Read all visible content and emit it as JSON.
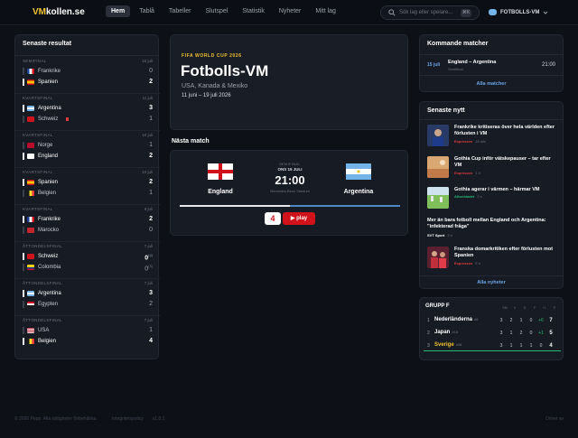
{
  "header": {
    "logo_highlight": "VM",
    "logo_rest": "kollen.se",
    "nav": [
      "Hem",
      "Tablå",
      "Tabeller",
      "Slutspel",
      "Statistik",
      "Nyheter",
      "Mitt lag"
    ],
    "search_placeholder": "Sök lag eller spelare...",
    "search_shortcut": "⌘K",
    "team_selector": "FOTBOLLS-VM"
  },
  "results": {
    "title": "Senaste resultat",
    "matches": [
      {
        "stage": "SEMIFINAL",
        "date": "15 juli",
        "home": {
          "name": "Frankrike",
          "score": "0",
          "win": false
        },
        "away": {
          "name": "Spanien",
          "score": "2",
          "win": true
        }
      },
      {
        "stage": "KVARTSFINAL",
        "date": "11 juli",
        "home": {
          "name": "Argentina",
          "score": "3",
          "win": true
        },
        "away": {
          "name": "Schweiz",
          "score": "1",
          "win": false
        }
      },
      {
        "stage": "KVARTSFINAL",
        "date": "10 juli",
        "home": {
          "name": "Norge",
          "score": "1",
          "win": false
        },
        "away": {
          "name": "England",
          "score": "2",
          "win": true
        }
      },
      {
        "stage": "KVARTSFINAL",
        "date": "10 juli",
        "home": {
          "name": "Spanien",
          "score": "2",
          "win": true
        },
        "away": {
          "name": "Belgien",
          "score": "1",
          "win": false
        }
      },
      {
        "stage": "KVARTSFINAL",
        "date": "9 juli",
        "home": {
          "name": "Frankrike",
          "score": "2",
          "win": true
        },
        "away": {
          "name": "Marocko",
          "score": "0",
          "win": false
        }
      },
      {
        "stage": "ÅTTONDELSFINAL",
        "date": "7 juli",
        "home": {
          "name": "Schweiz",
          "score": "0",
          "pen": "(4)",
          "win": true
        },
        "away": {
          "name": "Colombia",
          "score": "0",
          "pen": "(3)",
          "win": false
        }
      },
      {
        "stage": "ÅTTONDELSFINAL",
        "date": "7 juli",
        "home": {
          "name": "Argentina",
          "score": "3",
          "win": true
        },
        "away": {
          "name": "Egypten",
          "score": "2",
          "win": false
        }
      },
      {
        "stage": "ÅTTONDELSFINAL",
        "date": "7 juli",
        "home": {
          "name": "USA",
          "score": "1",
          "win": false
        },
        "away": {
          "name": "Belgien",
          "score": "4",
          "win": true
        }
      }
    ]
  },
  "hero": {
    "tag": "FIFA WORLD CUP 2026",
    "title": "Fotbolls-VM",
    "subtitle": "USA, Kanada & Mexiko",
    "dates": "11 juni – 19 juli 2026"
  },
  "next_match": {
    "label": "Nästa match",
    "home": "England",
    "away": "Argentina",
    "stage": "SEMIFINAL",
    "date": "ONS 15 JULI",
    "time": "21:00",
    "venue": "Mercedes-Benz Stadium",
    "tv_channel": "4",
    "tv_play": "▶ play"
  },
  "upcoming": {
    "title": "Kommande matcher",
    "date": "15 juli",
    "teams": "England – Argentina",
    "stage": "Semifinal",
    "time": "21:00",
    "link": "Alla matcher"
  },
  "news": {
    "title": "Senaste nytt",
    "items": [
      {
        "title": "Frankrike kritiseras över hela världen efter förlusten i VM",
        "source": "Expressen",
        "ago": "16 min"
      },
      {
        "title": "Gothia Cup inför vätskepauser – tar efter VM",
        "source": "Expressen",
        "ago": "1 h"
      },
      {
        "title": "Gothia agerar i värmen – härmar VM",
        "source": "Aftonbladet",
        "ago": "2 h"
      },
      {
        "title": "Mer än bara fotboll mellan England och Argentina: \"infekterad fråga\"",
        "source": "SVT Sport",
        "ago": "3 h"
      },
      {
        "title": "Franska domarkritiken efter förlusten mot Spanien",
        "source": "Expressen",
        "ago": "5 h"
      }
    ],
    "link": "Alla nyheter"
  },
  "group": {
    "title": "GRUPP F",
    "columns": [
      "SM",
      "V",
      "O",
      "F",
      "+/-",
      "P"
    ],
    "rows": [
      {
        "pos": "1",
        "team": "Nederländerna",
        "rank": "#6",
        "sm": "3",
        "v": "2",
        "o": "1",
        "f": "0",
        "diff": "+6",
        "p": "7"
      },
      {
        "pos": "2",
        "team": "Japan",
        "rank": "#18",
        "sm": "3",
        "v": "1",
        "o": "2",
        "f": "0",
        "diff": "+1",
        "p": "5"
      },
      {
        "pos": "3",
        "team": "Sverige",
        "rank": "#38",
        "sm": "3",
        "v": "1",
        "o": "1",
        "f": "1",
        "diff": "0",
        "p": "4"
      }
    ]
  },
  "footer": {
    "copy": "© 2026 Pepp. Alla rättigheter förbehållna.",
    "links": [
      "Integritetspolicy",
      "v1.8.1"
    ],
    "right": "Drivet av"
  },
  "colors": {
    "accent": "#f2c230",
    "link": "#6aa6e8",
    "bg": "#0d1017",
    "panel": "#171b23",
    "positive": "#2bb673"
  }
}
